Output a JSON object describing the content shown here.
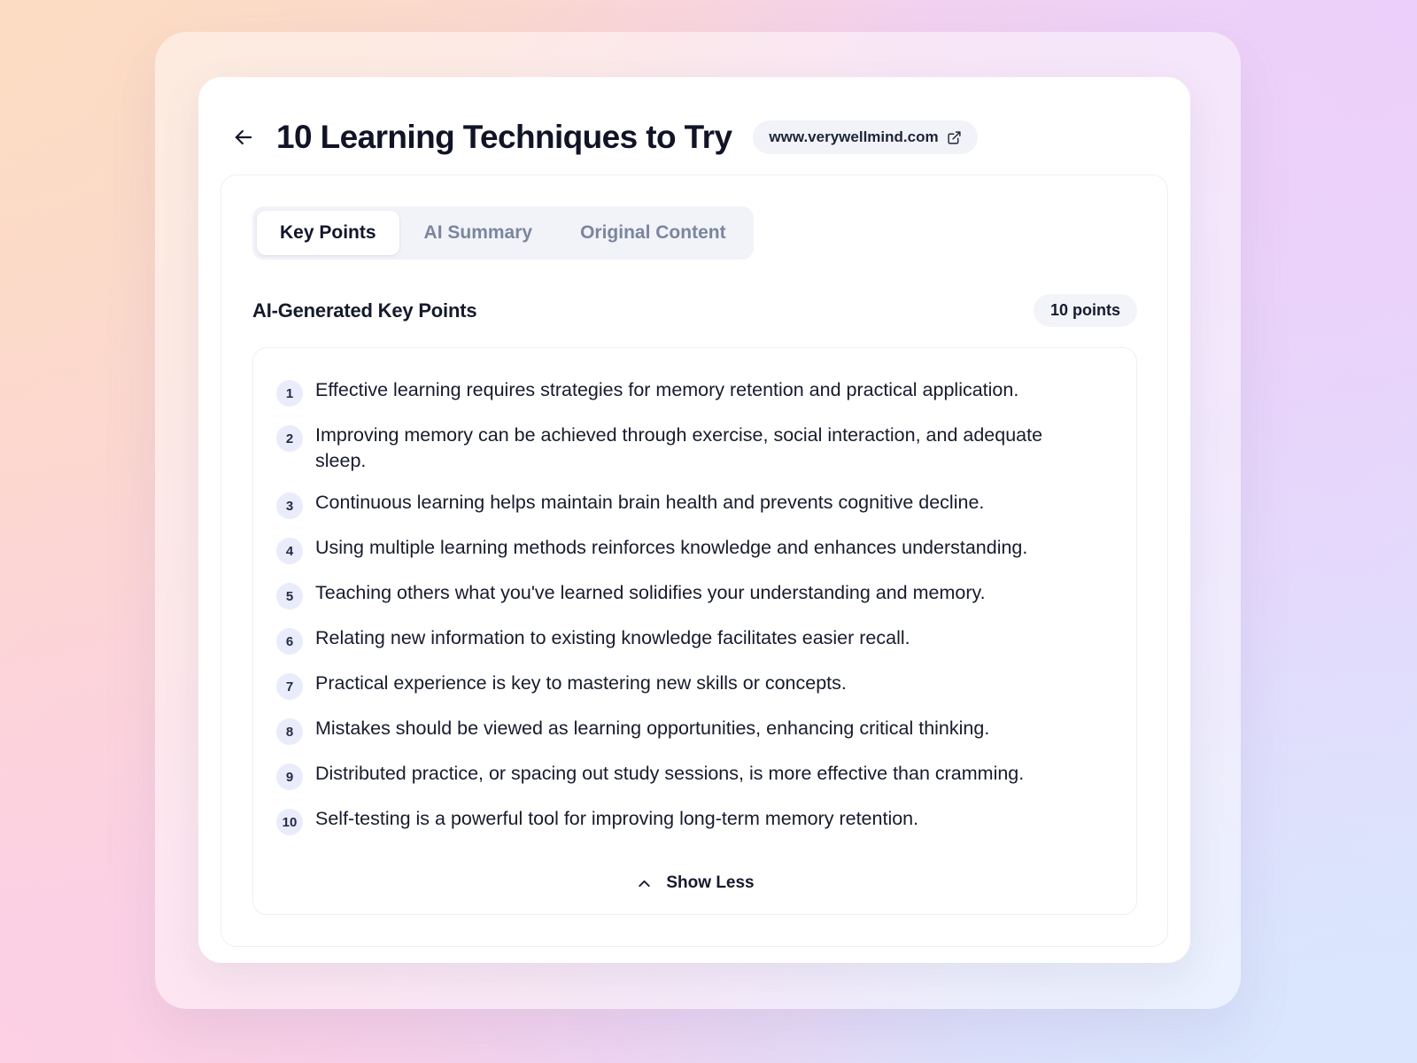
{
  "header": {
    "back_icon": "arrow-left-icon",
    "title": "10 Learning Techniques to Try",
    "source_url": "www.verywellmind.com",
    "external_link_icon": "external-link-icon"
  },
  "tabs": [
    {
      "label": "Key Points",
      "active": true
    },
    {
      "label": "AI Summary",
      "active": false
    },
    {
      "label": "Original Content",
      "active": false
    }
  ],
  "section": {
    "title": "AI-Generated Key Points",
    "count_badge": "10 points"
  },
  "points": [
    {
      "num": "1",
      "text": "Effective learning requires strategies for memory retention and practical application."
    },
    {
      "num": "2",
      "text": "Improving memory can be achieved through exercise, social interaction, and adequate sleep."
    },
    {
      "num": "3",
      "text": "Continuous learning helps maintain brain health and prevents cognitive decline."
    },
    {
      "num": "4",
      "text": "Using multiple learning methods reinforces knowledge and enhances understanding."
    },
    {
      "num": "5",
      "text": "Teaching others what you've learned solidifies your understanding and memory."
    },
    {
      "num": "6",
      "text": "Relating new information to existing knowledge facilitates easier recall."
    },
    {
      "num": "7",
      "text": "Practical experience is key to mastering new skills or concepts."
    },
    {
      "num": "8",
      "text": "Mistakes should be viewed as learning opportunities, enhancing critical thinking."
    },
    {
      "num": "9",
      "text": "Distributed practice, or spacing out study sessions, is more effective than cramming."
    },
    {
      "num": "10",
      "text": "Self-testing is a powerful tool for improving long-term memory retention."
    }
  ],
  "footer": {
    "toggle_label": "Show Less",
    "toggle_icon": "chevron-up-icon"
  },
  "colors": {
    "accent_badge_bg": "#e9ecfb",
    "chip_bg": "#f1f3f9",
    "text_primary": "#11152a",
    "text_muted": "#7b869d",
    "card_bg": "#ffffff",
    "border": "#eceff6"
  }
}
